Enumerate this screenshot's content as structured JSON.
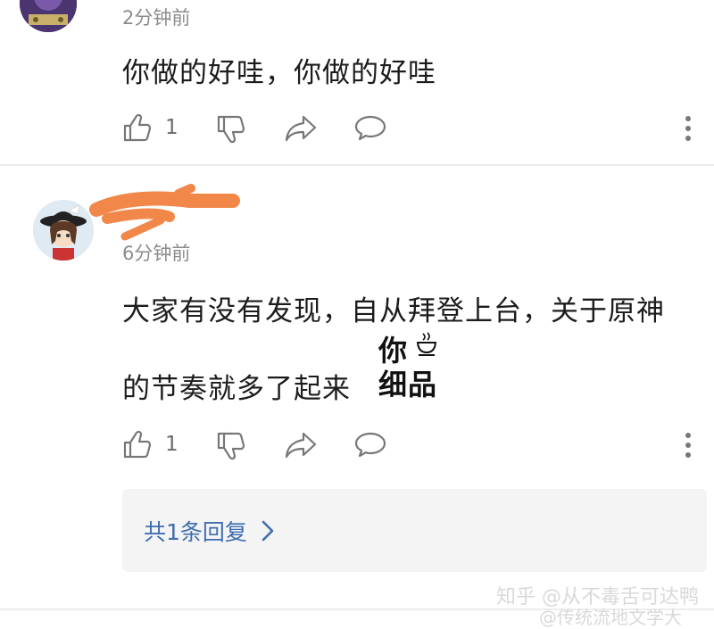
{
  "comments": [
    {
      "time": "2分钟前",
      "text": "你做的好哇，你做的好哇",
      "like_count": "1"
    },
    {
      "time": "6分钟前",
      "text_line1": "大家有没有发现，自从拜登上台，关于原神",
      "text_line2": "的节奏就多了起来",
      "sticker_text_line1": "你",
      "sticker_text_line2": "细品",
      "like_count": "1",
      "reply_link": "共1条回复"
    }
  ],
  "icons": {
    "like": "thumbs-up-icon",
    "dislike": "thumbs-down-icon",
    "share": "share-icon",
    "comment": "comment-icon",
    "more": "more-vertical-icon",
    "reply_chevron": "chevron-right-icon"
  },
  "watermark": {
    "line1": "知乎 @从不毒舌可达鸭",
    "line2": "@传统流地文学大"
  },
  "colors": {
    "link": "#3f6db0",
    "redaction": "#f2874a",
    "text": "#1c1c1c",
    "meta": "#8c8c8c"
  }
}
